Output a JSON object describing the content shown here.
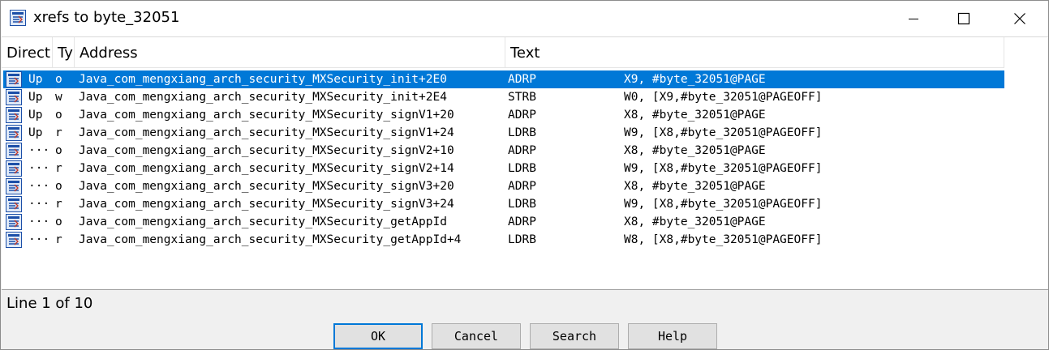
{
  "window": {
    "title": "xrefs to byte_32051",
    "icon": "xrefs-window-icon",
    "controls": {
      "minimize": "minimize-icon",
      "maximize": "maximize-icon",
      "close": "close-icon"
    }
  },
  "columns": [
    "Direct",
    "Ty",
    "Address",
    "Text"
  ],
  "rows": [
    {
      "dir": "Up",
      "type": "o",
      "address": "Java_com_mengxiang_arch_security_MXSecurity_init+2E0",
      "mnemonic": "ADRP",
      "operands": "X9, #byte_32051@PAGE",
      "selected": true
    },
    {
      "dir": "Up",
      "type": "w",
      "address": "Java_com_mengxiang_arch_security_MXSecurity_init+2E4",
      "mnemonic": "STRB",
      "operands": "W0, [X9,#byte_32051@PAGEOFF]",
      "selected": false
    },
    {
      "dir": "Up",
      "type": "o",
      "address": "Java_com_mengxiang_arch_security_MXSecurity_signV1+20",
      "mnemonic": "ADRP",
      "operands": "X8, #byte_32051@PAGE",
      "selected": false
    },
    {
      "dir": "Up",
      "type": "r",
      "address": "Java_com_mengxiang_arch_security_MXSecurity_signV1+24",
      "mnemonic": "LDRB",
      "operands": "W9, [X8,#byte_32051@PAGEOFF]",
      "selected": false
    },
    {
      "dir": "···",
      "type": "o",
      "address": "Java_com_mengxiang_arch_security_MXSecurity_signV2+10",
      "mnemonic": "ADRP",
      "operands": "X8, #byte_32051@PAGE",
      "selected": false
    },
    {
      "dir": "···",
      "type": "r",
      "address": "Java_com_mengxiang_arch_security_MXSecurity_signV2+14",
      "mnemonic": "LDRB",
      "operands": "W9, [X8,#byte_32051@PAGEOFF]",
      "selected": false
    },
    {
      "dir": "···",
      "type": "o",
      "address": "Java_com_mengxiang_arch_security_MXSecurity_signV3+20",
      "mnemonic": "ADRP",
      "operands": "X8, #byte_32051@PAGE",
      "selected": false
    },
    {
      "dir": "···",
      "type": "r",
      "address": "Java_com_mengxiang_arch_security_MXSecurity_signV3+24",
      "mnemonic": "LDRB",
      "operands": "W9, [X8,#byte_32051@PAGEOFF]",
      "selected": false
    },
    {
      "dir": "···",
      "type": "o",
      "address": "Java_com_mengxiang_arch_security_MXSecurity_getAppId",
      "mnemonic": "ADRP",
      "operands": "X8, #byte_32051@PAGE",
      "selected": false
    },
    {
      "dir": "···",
      "type": "r",
      "address": "Java_com_mengxiang_arch_security_MXSecurity_getAppId+4",
      "mnemonic": "LDRB",
      "operands": "W8, [X8,#byte_32051@PAGEOFF]",
      "selected": false
    }
  ],
  "status": "Line 1 of 10",
  "buttons": {
    "ok": "OK",
    "cancel": "Cancel",
    "search": "Search",
    "help": "Help"
  },
  "colors": {
    "selection": "#0078d7",
    "default_button_border": "#0078d7"
  }
}
